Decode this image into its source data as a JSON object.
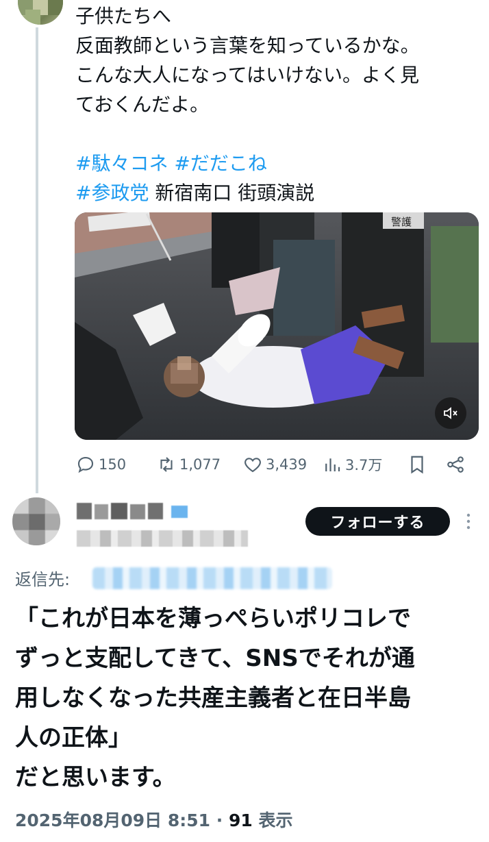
{
  "tweet": {
    "lines": [
      "子供たちへ",
      "反面教師という言葉を知っているかな。",
      "こんな大人になってはいけない。よく見",
      "ておくんだよ。"
    ],
    "hashtags_line1": [
      "#駄々コネ",
      "#だだこね"
    ],
    "hashtag_line2": "#参政党",
    "location_text": "新宿南口 街頭演説",
    "media": {
      "vest_label": "警護",
      "sound_icon": "speaker-muted-icon"
    },
    "actions": {
      "replies": "150",
      "retweets": "1,077",
      "likes": "3,439",
      "views": "3.7万"
    }
  },
  "reply": {
    "follow_label": "フォローする",
    "reply_to_label": "返信先:",
    "text_lines": [
      "「これが日本を薄っぺらいポリコレで",
      "ずっと支配してきて、SNSでそれが通",
      "用しなくなった共産主義者と在日半島",
      "人の正体」",
      "だと思います。"
    ],
    "timestamp": "2025年08月09日 8:51",
    "separator": "·",
    "view_count": "91",
    "view_label": "表示"
  },
  "colors": {
    "accent": "#1d9bf0",
    "text": "#0f1419",
    "muted": "#536471",
    "button_bg": "#0f1419"
  }
}
